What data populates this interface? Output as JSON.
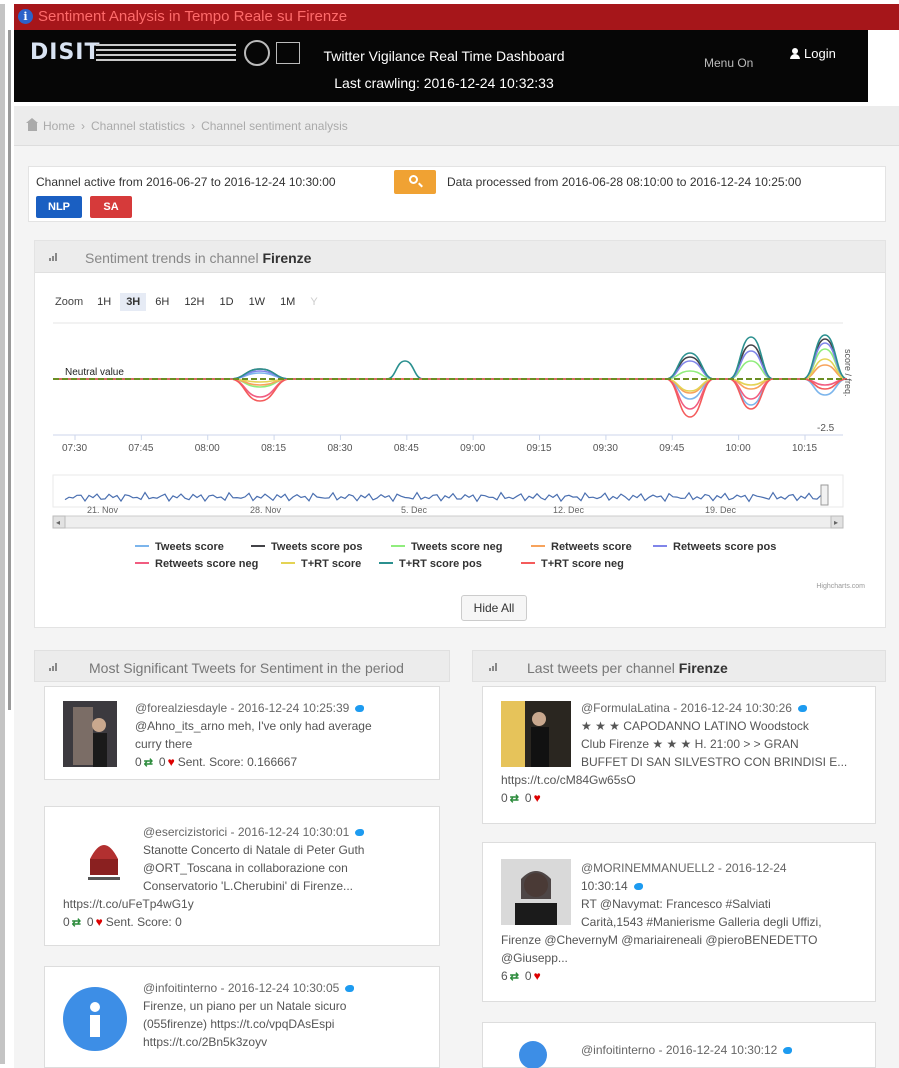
{
  "window": {
    "title": "Sentiment Analysis in Tempo Reale su Firenze"
  },
  "header": {
    "logo": "DISIT",
    "dashboard_title": "Twitter Vigilance Real Time Dashboard",
    "last_crawling": "Last crawling: 2016-12-24 10:32:33",
    "menu": "Menu On",
    "login": "Login"
  },
  "breadcrumb": {
    "items": [
      "Home",
      "Channel statistics",
      "Channel sentiment analysis"
    ]
  },
  "info": {
    "channel_active": "Channel active from 2016-06-27 to 2016-12-24 10:30:00",
    "data_processed": "Data processed from 2016-06-28 08:10:00 to 2016-12-24 10:25:00",
    "nlp": "NLP",
    "sa": "SA"
  },
  "trend": {
    "title_prefix": "Sentiment trends in channel",
    "channel": "Firenze",
    "zoom_label": "Zoom",
    "zoom_options": [
      "1H",
      "3H",
      "6H",
      "12H",
      "1D",
      "1W",
      "1M",
      "Y"
    ],
    "zoom_active": "3H",
    "neutral_label": "Neutral value",
    "y_axis_label": "score / freq.",
    "y_tick": "-2.5",
    "x_ticks": [
      "07:30",
      "07:45",
      "08:00",
      "08:15",
      "08:30",
      "08:45",
      "09:00",
      "09:15",
      "09:30",
      "09:45",
      "10:00",
      "10:15"
    ],
    "navigator_ticks": [
      "21. Nov",
      "28. Nov",
      "5. Dec",
      "12. Dec",
      "19. Dec"
    ],
    "credit": "Highcharts.com",
    "hide_all": "Hide All",
    "series": [
      {
        "name": "Tweets score",
        "color": "#7cb5ec"
      },
      {
        "name": "Tweets score pos",
        "color": "#434348"
      },
      {
        "name": "Tweets score neg",
        "color": "#90ed7d"
      },
      {
        "name": "Retweets score",
        "color": "#f7a35c"
      },
      {
        "name": "Retweets score pos",
        "color": "#8085e9"
      },
      {
        "name": "Retweets score neg",
        "color": "#f15c80"
      },
      {
        "name": "T+RT score",
        "color": "#e4d354"
      },
      {
        "name": "T+RT score pos",
        "color": "#2b908f"
      },
      {
        "name": "T+RT score neg",
        "color": "#f45b5b"
      }
    ]
  },
  "significant": {
    "title": "Most Significant Tweets for Sentiment in the period",
    "tweets": [
      {
        "meta": "@forealziesdayle - 2016-12-24 10:25:39",
        "lines": [
          "@Ahno_its_arno meh, I've only had average",
          "curry there"
        ],
        "rt": "0",
        "fav": "0",
        "score": "Sent. Score: 0.166667"
      },
      {
        "meta": "@esercizistorici - 2016-12-24 10:30:01",
        "lines": [
          "Stanotte Concerto di Natale di Peter Guth",
          "@ORT_Toscana in collaborazione con",
          "Conservatorio 'L.Cherubini' di Firenze..."
        ],
        "link": "https://t.co/uFeTp4wG1y",
        "rt": "0",
        "fav": "0",
        "score": "Sent. Score: 0"
      },
      {
        "meta": "@infoitinterno - 2016-12-24 10:30:05",
        "lines": [
          "Firenze, un piano per un Natale sicuro",
          "(055firenze) https://t.co/vpqDAsEspi",
          "https://t.co/2Bn5k3zoyv"
        ]
      }
    ]
  },
  "last": {
    "title_prefix": "Last tweets per channel",
    "channel": "Firenze",
    "tweets": [
      {
        "meta": "@FormulaLatina - 2016-12-24 10:30:26",
        "lines": [
          "★ ★ ★ CAPODANNO LATINO Woodstock",
          "Club Firenze ★ ★ ★ H. 21:00 > > GRAN",
          "BUFFET DI SAN SILVESTRO CON BRINDISI E..."
        ],
        "link": "https://t.co/cM84Gw65sO",
        "rt": "0",
        "fav": "0"
      },
      {
        "meta": "@MORINEMMANUELL2 - 2016-12-24",
        "meta2": "10:30:14",
        "lines": [
          "RT @Navymat: Francesco #Salviati",
          "Carità,1543 #Manierisme Galleria degli Uffizi,"
        ],
        "wide": [
          "Firenze @ChevernyM @mariaireneali @pieroBENEDETTO",
          "@Giusepp..."
        ],
        "rt": "6",
        "fav": "0"
      },
      {
        "meta": "@infoitinterno - 2016-12-24 10:30:12"
      }
    ]
  }
}
